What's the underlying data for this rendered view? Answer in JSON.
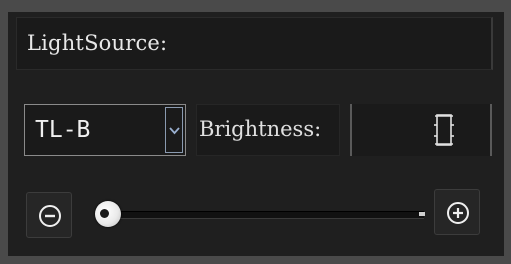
{
  "title": "LightSource:",
  "light_source": {
    "selected": "TL-B",
    "arrow_icon": "chevron-down-icon"
  },
  "brightness": {
    "label": "Brightness:",
    "value": "0",
    "slider_level": 0
  },
  "controls": {
    "minus_icon": "circled-minus-icon",
    "plus_icon": "circled-plus-icon"
  },
  "colors": {
    "panel_bg": "#1f1f1f",
    "text": "#e8e8e8",
    "arrow_accent": "#8a9ab0"
  }
}
